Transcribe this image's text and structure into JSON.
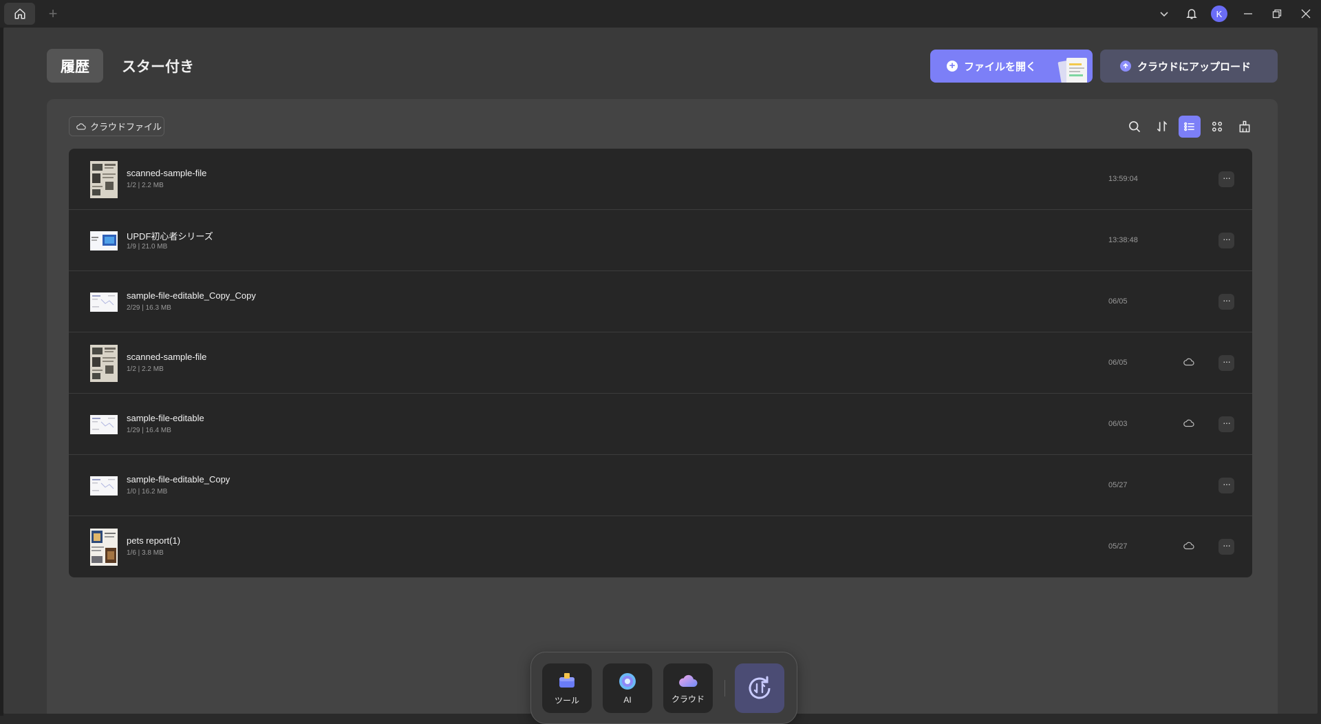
{
  "titlebar": {
    "add_tab": "+",
    "avatar_initial": "K"
  },
  "header": {
    "tab_history": "履歴",
    "tab_starred": "スター付き",
    "open_file": "ファイルを開く",
    "upload_cloud": "クラウドにアップロード"
  },
  "panel": {
    "cloud_files": "クラウドファイル"
  },
  "files": [
    {
      "name": "scanned-sample-file",
      "meta": "1/2 | 2.2 MB",
      "date": "13:59:04",
      "cloud": false,
      "thumb": "scan"
    },
    {
      "name": "UPDF初心者シリーズ",
      "meta": "1/9 | 21.0 MB",
      "date": "13:38:48",
      "cloud": false,
      "thumb": "slide"
    },
    {
      "name": "sample-file-editable_Copy_Copy",
      "meta": "2/29 | 16.3 MB",
      "date": "06/05",
      "cloud": false,
      "thumb": "doc"
    },
    {
      "name": "scanned-sample-file",
      "meta": "1/2 | 2.2 MB",
      "date": "06/05",
      "cloud": true,
      "thumb": "scan"
    },
    {
      "name": "sample-file-editable",
      "meta": "1/29 | 16.4 MB",
      "date": "06/03",
      "cloud": true,
      "thumb": "doc"
    },
    {
      "name": "sample-file-editable_Copy",
      "meta": "1/0 | 16.2 MB",
      "date": "05/27",
      "cloud": false,
      "thumb": "doc"
    },
    {
      "name": "pets report(1)",
      "meta": "1/6 | 3.8 MB",
      "date": "05/27",
      "cloud": true,
      "thumb": "pets"
    }
  ],
  "more_label": "···",
  "dock": {
    "tools": "ツール",
    "ai": "AI",
    "cloud": "クラウド"
  },
  "colors": {
    "accent": "#7c7ff7",
    "background": "#3a3a3a",
    "list_bg": "#262626"
  }
}
